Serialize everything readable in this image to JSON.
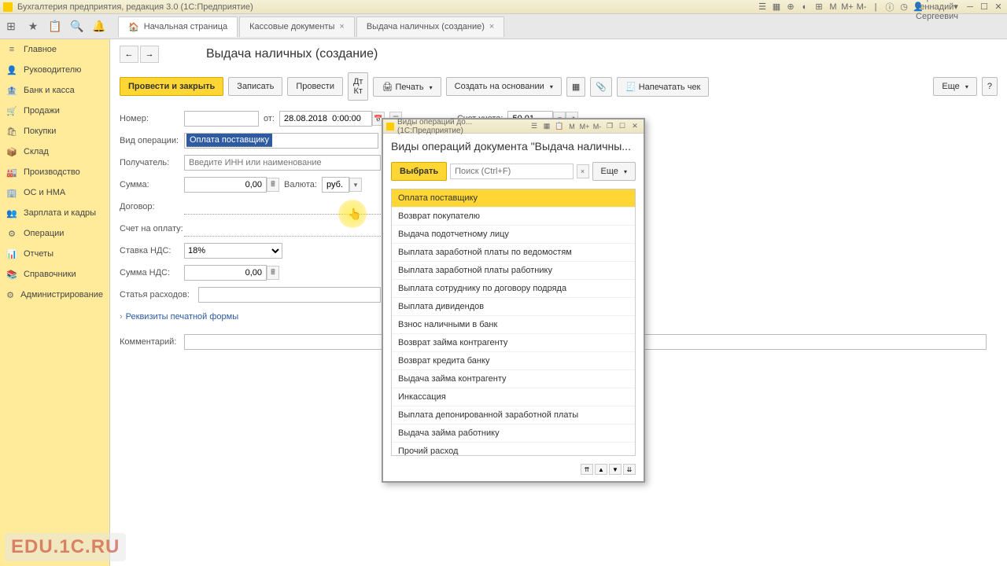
{
  "titlebar": {
    "title": "Бухгалтерия предприятия, редакция 3.0  (1С:Предприятие)",
    "username": "Абрамов Геннадий Сергеевич"
  },
  "tabs": {
    "home": "Начальная страница",
    "t1": "Кассовые документы",
    "t2": "Выдача наличных (создание)"
  },
  "sidebar": [
    "Главное",
    "Руководителю",
    "Банк и касса",
    "Продажи",
    "Покупки",
    "Склад",
    "Производство",
    "ОС и НМА",
    "Зарплата и кадры",
    "Операции",
    "Отчеты",
    "Справочники",
    "Администрирование"
  ],
  "page": {
    "title": "Выдача наличных (создание)",
    "actions": {
      "post_close": "Провести и закрыть",
      "save": "Записать",
      "post": "Провести",
      "print": "Печать",
      "create_based": "Создать на основании",
      "receipt": "Напечатать чек",
      "more": "Еще"
    }
  },
  "form": {
    "number_label": "Номер:",
    "from_label": "от:",
    "date_value": "28.08.2018  0:00:00",
    "account_label": "Счет учета:",
    "account_value": "50.01",
    "operation_label": "Вид операции:",
    "operation_value": "Оплата поставщику",
    "recipient_label": "Получатель:",
    "recipient_placeholder": "Введите ИНН или наименование",
    "sum_label": "Сумма:",
    "sum_value": "0,00",
    "currency_label": "Валюта:",
    "currency_value": "руб.",
    "contract_label": "Договор:",
    "invoice_label": "Счет на оплату:",
    "vat_rate_label": "Ставка НДС:",
    "vat_rate_value": "18%",
    "vat_sum_label": "Сумма НДС:",
    "vat_sum_value": "0,00",
    "expense_label": "Статья расходов:",
    "print_requisites": "Реквизиты печатной формы",
    "comment_label": "Комментарий:"
  },
  "modal": {
    "titlebar": "Виды операций до...  (1С:Предприятие)",
    "title": "Виды операций документа \"Выдача наличны...",
    "select_btn": "Выбрать",
    "search_placeholder": "Поиск (Ctrl+F)",
    "more": "Еще",
    "items": [
      "Оплата поставщику",
      "Возврат покупателю",
      "Выдача подотчетному лицу",
      "Выплата заработной платы по ведомостям",
      "Выплата заработной платы работнику",
      "Выплата сотруднику по договору подряда",
      "Выплата дивидендов",
      "Взнос наличными в банк",
      "Возврат займа контрагенту",
      "Возврат кредита банку",
      "Выдача займа контрагенту",
      "Инкассация",
      "Выплата депонированной заработной платы",
      "Выдача займа работнику",
      "Прочий расход"
    ]
  },
  "watermark": "EDU.1C.RU"
}
